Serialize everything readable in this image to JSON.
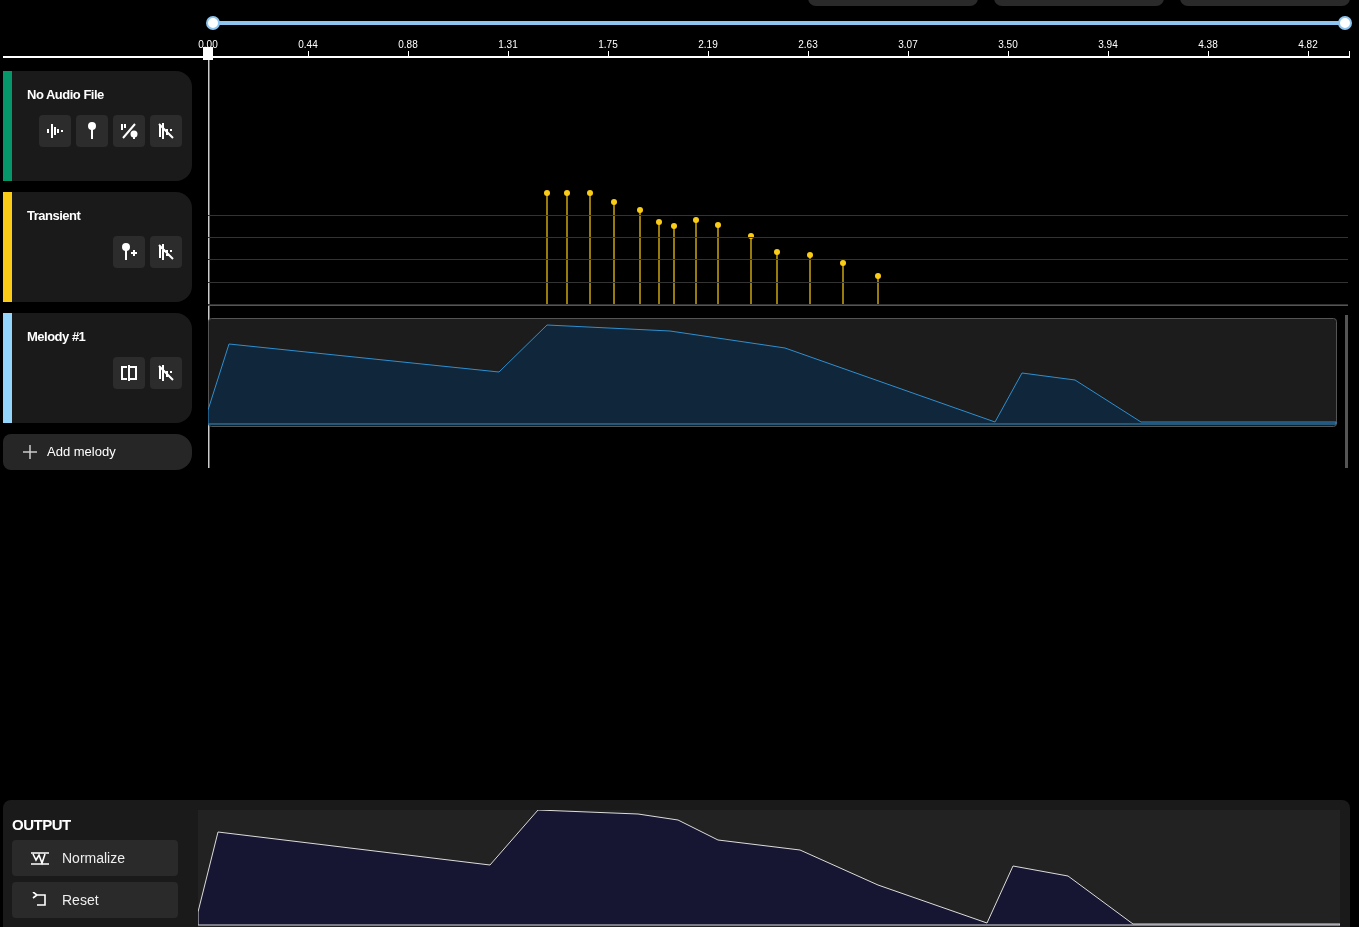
{
  "timeline": {
    "ticks": [
      "0.00",
      "0.44",
      "0.88",
      "1.31",
      "1.75",
      "2.19",
      "2.63",
      "3.07",
      "3.50",
      "3.94",
      "4.38",
      "4.82"
    ]
  },
  "tracks": [
    {
      "kind": "audio",
      "title": "No Audio File",
      "color": "#059669",
      "tools": [
        {
          "kind": "waveform"
        },
        {
          "kind": "marker"
        },
        {
          "kind": "marker-split"
        },
        {
          "kind": "mute"
        }
      ]
    },
    {
      "kind": "transient",
      "title": "Transient",
      "color": "#facc15",
      "tools": [
        {
          "kind": "add-marker"
        },
        {
          "kind": "mute"
        }
      ]
    },
    {
      "kind": "melody",
      "title": "Melody #1",
      "color": "#93d5fb",
      "tools": [
        {
          "kind": "split"
        },
        {
          "kind": "mute"
        }
      ]
    }
  ],
  "add_melody": {
    "label": "Add melody"
  },
  "output": {
    "title": "OUTPUT",
    "buttons": [
      {
        "kind": "normalize",
        "label": "Normalize"
      },
      {
        "kind": "reset",
        "label": "Reset"
      }
    ]
  }
}
